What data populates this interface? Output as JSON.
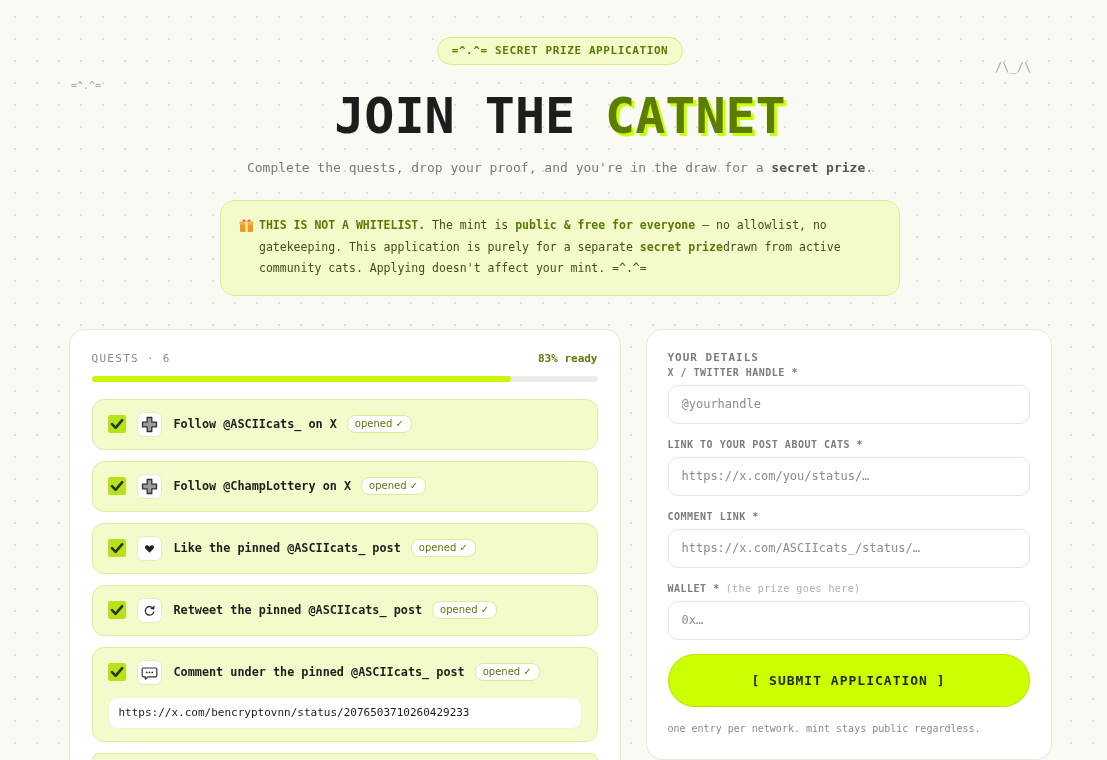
{
  "doodles": {
    "left": "=^.^=",
    "right": "/\\_/\\"
  },
  "header": {
    "badge": "=^.^= SECRET PRIZE APPLICATION",
    "title": "JOIN THE",
    "title_highlight": "CATNET",
    "subtitle": "Complete the quests, drop your proof, and you're in the draw for a **secret prize**."
  },
  "notice": {
    "text": "**THIS IS NOT A WHITELIST.** The mint is **public & free for everyone** — no allowlist, no gatekeeping. This application is purely for a separate **secret prize**drawn from active community cats. Applying doesn't affect your mint. =^.^="
  },
  "quests_panel": {
    "title": "QUESTS · 6",
    "reading": "83% ready",
    "level": 0.83,
    "more_below": true,
    "quests": [
      {
        "kind": "follow",
        "label": "Follow @ASCIIcats_ on X",
        "checked": true,
        "status": "opened ✓"
      },
      {
        "kind": "follow",
        "label": "Follow @ChampLottery on X",
        "checked": true,
        "status": "opened ✓"
      },
      {
        "kind": "like",
        "label": "Like the pinned @ASCIIcats_ post",
        "checked": true,
        "status": "opened ✓"
      },
      {
        "kind": "retweet",
        "label": "Retweet the pinned @ASCIIcats_ post",
        "checked": true,
        "status": "opened ✓"
      },
      {
        "kind": "comment",
        "label": "Comment under the pinned @ASCIIcats_ post",
        "checked": true,
        "status": "opened ✓",
        "link": "https://x.com/bencryptovnn/status/2076503710260429233"
      }
    ]
  },
  "details_panel": {
    "title": "YOUR DETAILS",
    "fields": [
      {
        "label": "X / TWITTER HANDLE *",
        "placeholder": "@yourhandle"
      },
      {
        "label": "LINK TO YOUR POST ABOUT CATS *",
        "placeholder": "https://x.com/you/status/…"
      },
      {
        "label": "COMMENT LINK *",
        "placeholder": "https://x.com/ASCIIcats_/status/…"
      },
      {
        "label": "WALLET *",
        "hint": "(the prize goes here)",
        "placeholder": "0x…"
      }
    ],
    "submit": "[ SUBMIT APPLICATION ]",
    "note": "one entry per network. mint stays public regardless."
  }
}
